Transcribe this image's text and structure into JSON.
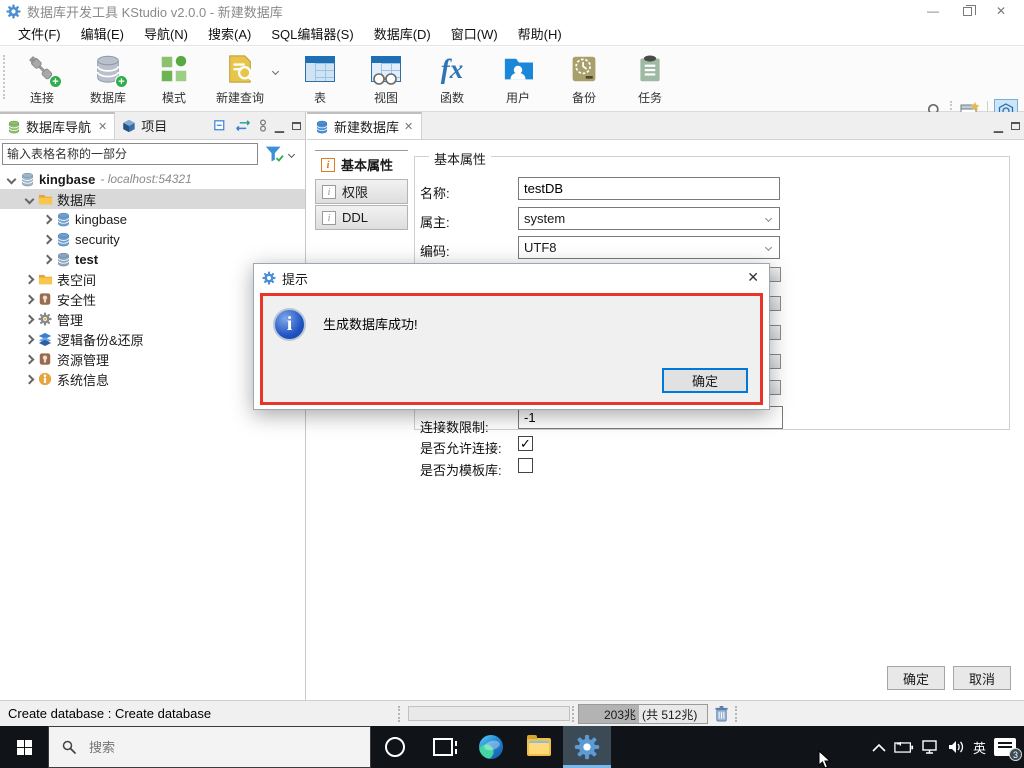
{
  "colors": {
    "accent": "#0078d7",
    "alert_red": "#e8352a",
    "taskbar_underline": "#76b9ed",
    "selection_gray": "#d9d9d9"
  },
  "window": {
    "title": "数据库开发工具 KStudio v2.0.0 - 新建数据库",
    "controls": {
      "minimize": "—",
      "close": "✕"
    }
  },
  "menu": {
    "items": [
      "文件(F)",
      "编辑(E)",
      "导航(N)",
      "搜索(A)",
      "SQL编辑器(S)",
      "数据库(D)",
      "窗口(W)",
      "帮助(H)"
    ]
  },
  "toolbar": {
    "buttons": [
      "连接",
      "数据库",
      "模式",
      "新建查询",
      "表",
      "视图",
      "函数",
      "用户",
      "备份",
      "任务"
    ]
  },
  "left_panel": {
    "tabs": [
      {
        "label": "数据库导航"
      },
      {
        "label": "项目"
      }
    ],
    "search_placeholder": "输入表格名称的一部分",
    "tree": [
      {
        "label": "kingbase",
        "suffix": "- localhost:54321"
      },
      {
        "label": "数据库"
      },
      {
        "label": "kingbase"
      },
      {
        "label": "security"
      },
      {
        "label": "test"
      },
      {
        "label": "表空间"
      },
      {
        "label": "安全性"
      },
      {
        "label": "管理"
      },
      {
        "label": "逻辑备份&还原"
      },
      {
        "label": "资源管理"
      },
      {
        "label": "系统信息"
      }
    ]
  },
  "editor": {
    "tab_label": "新建数据库",
    "side_tabs": [
      "基本属性",
      "权限",
      "DDL"
    ],
    "group_legend": "基本属性",
    "fields": {
      "name_label": "名称:",
      "name_value": "testDB",
      "owner_label": "属主:",
      "owner_value": "system",
      "encoding_label": "编码:",
      "encoding_value": "UTF8",
      "conn_limit_label": "连接数限制:",
      "conn_limit_value": "-1",
      "allow_conn_label": "是否允许连接:",
      "allow_conn_checked": true,
      "checkmark": "✓",
      "template_label": "是否为模板库:",
      "template_checked": false
    },
    "footer": {
      "ok": "确定",
      "cancel": "取消"
    }
  },
  "dialog": {
    "title": "提示",
    "message": "生成数据库成功!",
    "ok": "确定",
    "info_glyph": "i"
  },
  "status_bar": {
    "text": "Create database : Create database",
    "memory_used": "203兆",
    "memory_total": "(共 512兆)"
  },
  "taskbar": {
    "search_placeholder": "搜索",
    "language": "英",
    "notification_count": "3"
  }
}
